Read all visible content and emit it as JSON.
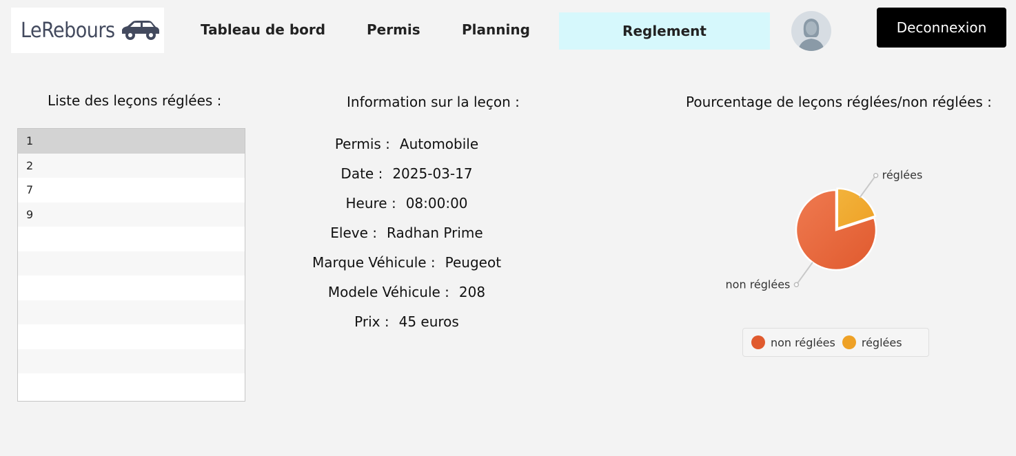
{
  "header": {
    "logo_text": "LeRebours",
    "nav": [
      {
        "label": "Tableau de bord"
      },
      {
        "label": "Permis"
      },
      {
        "label": "Planning"
      },
      {
        "label": "Reglement",
        "active": true
      }
    ],
    "logout_label": "Deconnexion"
  },
  "left": {
    "title": "Liste des leçons réglées :",
    "items": [
      "1",
      "2",
      "7",
      "9"
    ],
    "selected_index": 0
  },
  "info": {
    "title": "Information sur la leçon :",
    "rows": [
      {
        "label": "Permis :",
        "value": "Automobile"
      },
      {
        "label": "Date :",
        "value": "2025-03-17"
      },
      {
        "label": "Heure :",
        "value": "08:00:00"
      },
      {
        "label": "Eleve :",
        "value": "Radhan Prime"
      },
      {
        "label": "Marque Véhicule :",
        "value": "Peugeot"
      },
      {
        "label": "Modele Véhicule :",
        "value": "208"
      },
      {
        "label": "Prix :",
        "value": "45 euros"
      }
    ]
  },
  "chart_section": {
    "title": "Pourcentage de leçons réglées/non réglées :"
  },
  "chart_data": {
    "type": "pie",
    "slices": [
      {
        "label": "non réglées",
        "value": 4,
        "color": "#e05a2e"
      },
      {
        "label": "réglées",
        "value": 1,
        "color": "#eea126"
      }
    ],
    "legend": "bottom"
  },
  "colors": {
    "active_tab_bg": "#d6f8fc",
    "logout_bg": "#000000"
  }
}
